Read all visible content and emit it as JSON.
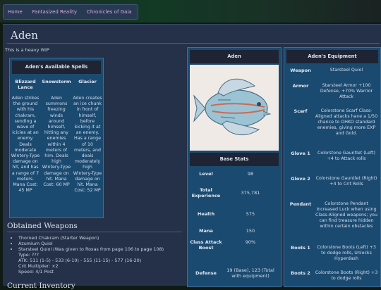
{
  "nav": {
    "items": [
      "Home",
      "Fantasized Reality",
      "Chronicles of Gaia"
    ]
  },
  "page": {
    "title": "Aden",
    "note": "This is a heavy WIP"
  },
  "spells": {
    "header": "Aden's Available Spells",
    "items": [
      {
        "name": "Blizzard Lance",
        "description": "Aden strikes the ground with his chakram, sending a wave of icicles at an enemy. Deals moderate Wintery-Type damage on hit, and has a range of 7 meters. Mana Cost: 45 MP"
      },
      {
        "name": "Snowstorm",
        "description": "Aden summons freezing winds around himself, hitting any enemies within 4 meters of him. Deals high Wintery-Type damage on hit. Mana Cost: 60 MP"
      },
      {
        "name": "Glacier",
        "description": "Aden creates an ice chunk in front of himself, before kicking it at an enemy. Has a range of 10 meters, and deals moderately high Wintery-Type damage on hit. Mana Cost: 52 MP"
      }
    ]
  },
  "weapons": {
    "heading": "Obtained Weapons",
    "items": [
      "Thorned Chakram (Starter Weapon)",
      "Azumium Quiol",
      "Starsteel Quiol (Was given to Roxas from page 106 to page 108)"
    ],
    "details": [
      "Type: ???",
      "ATK: 511 (1-5) - 533 (6-10) - 555 (11-15) - 577 (16-20)",
      "Crit Multiplier: ×2",
      "Speed: 4/1 Post"
    ]
  },
  "inventory_heading": "Current Inventory",
  "character": {
    "header": "Aden",
    "stats_header": "Base Stats",
    "stats": [
      {
        "label": "Level",
        "value": "98"
      },
      {
        "label": "Total Experience",
        "value": "375,781"
      },
      {
        "label": "Health",
        "value": "575"
      },
      {
        "label": "Mana",
        "value": "150"
      },
      {
        "label": "Class Attack Boost",
        "value": "90%"
      },
      {
        "label": "Defense",
        "value": "19 (Base), 123 (Total with equipment)"
      }
    ]
  },
  "equipment": {
    "header": "Aden's Equipment",
    "items": [
      {
        "slot": "Weapon",
        "value": "Starsteel Quiol"
      },
      {
        "slot": "Armor",
        "value": "Starsteel Armor +100 Defense, +70% Warrior Attack"
      },
      {
        "slot": "Scarf",
        "value": "Colorstone Scarf Class-Aligned attacks have a 1/50 chance to OHKO standard enemies, giving more EXP and Gold."
      },
      {
        "slot": "Glove 1",
        "value": "Colorstone Gauntlet (Left) +4 to Attack rolls"
      },
      {
        "slot": "Glove 2",
        "value": "Colorstone Gauntlet (Right) +4 to Crit Rolls"
      },
      {
        "slot": "Pendant",
        "value": "Colorstone Pendant Increased Luck when using Class-Aligned weapons; you can find treasure hidden within certain obstacles"
      },
      {
        "slot": "Boots 1",
        "value": "Colorstone Boots (Left) +3 to dodge rolls, Unlocks Hyperdash"
      },
      {
        "slot": "Boots 2",
        "value": "Colorstone Boots (Right) +3 to dodge rolls"
      }
    ]
  },
  "colors": {
    "panel": "#243148",
    "card": "#1b4a70",
    "card_header": "#1e2433",
    "nav_link": "#d9a9e9"
  }
}
